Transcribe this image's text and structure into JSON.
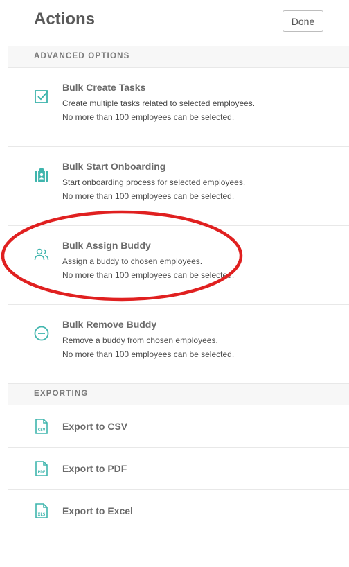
{
  "header": {
    "title": "Actions",
    "done_label": "Done"
  },
  "advanced": {
    "heading": "ADVANCED OPTIONS",
    "items": [
      {
        "title": "Bulk Create Tasks",
        "line1": "Create multiple tasks related to selected employees.",
        "line2": "No more than 100 employees can be selected.",
        "icon": "checkbox-icon"
      },
      {
        "title": "Bulk Start Onboarding",
        "line1": "Start onboarding process for selected employees.",
        "line2": "No more than 100 employees can be selected.",
        "icon": "onboarding-icon"
      },
      {
        "title": "Bulk Assign Buddy",
        "line1": "Assign a buddy to chosen employees.",
        "line2": "No more than 100 employees can be selected.",
        "icon": "users-icon"
      },
      {
        "title": "Bulk Remove Buddy",
        "line1": "Remove a buddy from chosen employees.",
        "line2": "No more than 100 employees can be selected.",
        "icon": "minus-circle-icon"
      }
    ]
  },
  "exporting": {
    "heading": "EXPORTING",
    "items": [
      {
        "title": "Export to CSV",
        "icon": "csv-file-icon",
        "badge": "CSV"
      },
      {
        "title": "Export to PDF",
        "icon": "pdf-file-icon",
        "badge": "PDF"
      },
      {
        "title": "Export to Excel",
        "icon": "xls-file-icon",
        "badge": "XLS"
      }
    ]
  },
  "colors": {
    "accent": "#3fb5ad",
    "annotation": "#e02020"
  }
}
